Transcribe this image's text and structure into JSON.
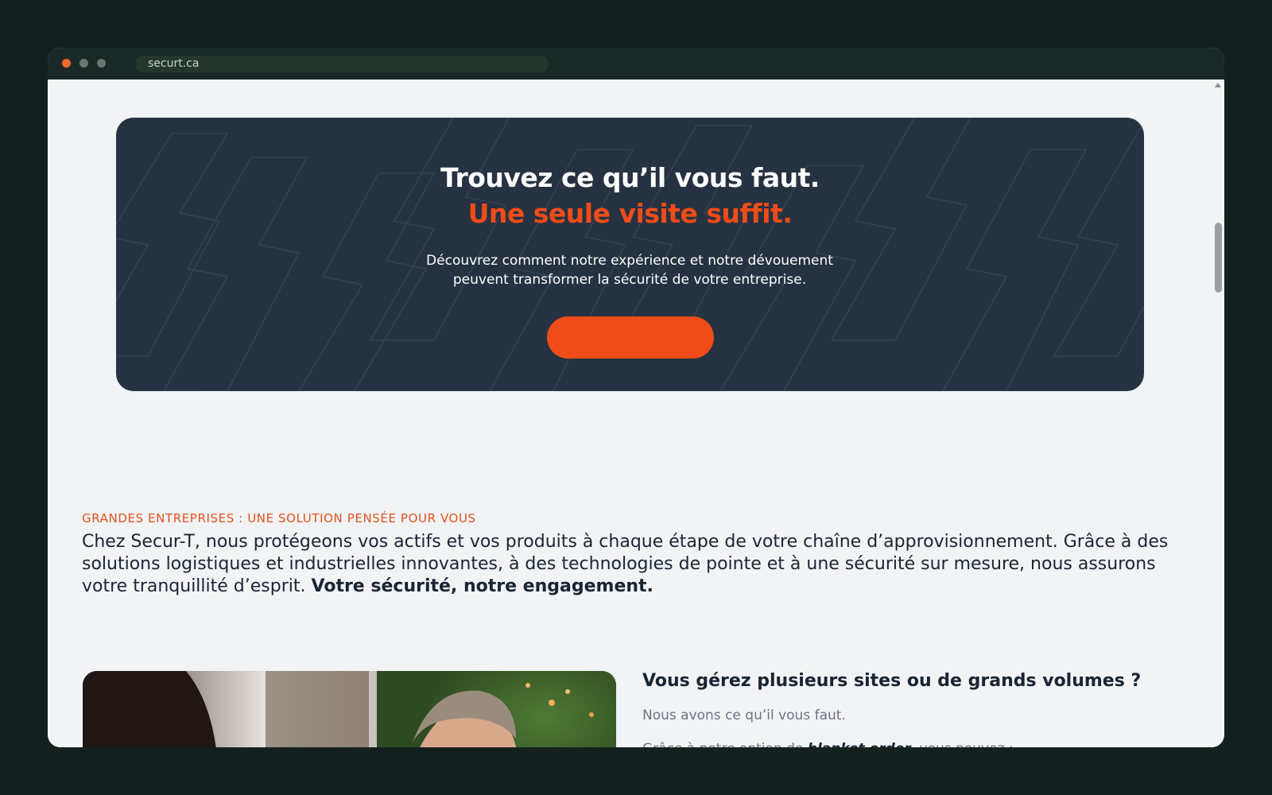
{
  "browser": {
    "url": "securt.ca",
    "dot_colors": [
      "#ef6a2e",
      "#6b7571",
      "#6b7571"
    ]
  },
  "cta": {
    "title": "Trouvez ce qu’il vous faut.",
    "subtitle": "Une seule visite suffit.",
    "text_line1": "Découvrez comment notre expérience et notre dévouement",
    "text_line2": "peuvent transformer la sécurité de votre entreprise.",
    "button_label": "",
    "background_color": "#263241",
    "accent_color": "#ef4c18"
  },
  "section": {
    "eyebrow": "GRANDES ENTREPRISES : UNE SOLUTION PENSÉE POUR VOUS",
    "intro_text": "Chez Secur-T, nous protégeons vos actifs et vos produits à chaque étape de votre chaîne d’approvisionnement. Grâce à des solutions logistiques et industrielles innovantes, à des technologies de pointe et à une sécurité sur mesure, nous assurons votre tranquillité d’esprit.",
    "intro_strong": "Votre sécurité, notre engagement."
  },
  "feature": {
    "heading": "Vous gérez plusieurs sites ou de grands volumes ?",
    "paragraph1": "Nous avons ce qu’il vous faut.",
    "paragraph2_before": "Grâce à notre option de ",
    "paragraph2_emphasis": "blanket order",
    "paragraph2_after": ", vous pouvez :",
    "button_label": ""
  }
}
